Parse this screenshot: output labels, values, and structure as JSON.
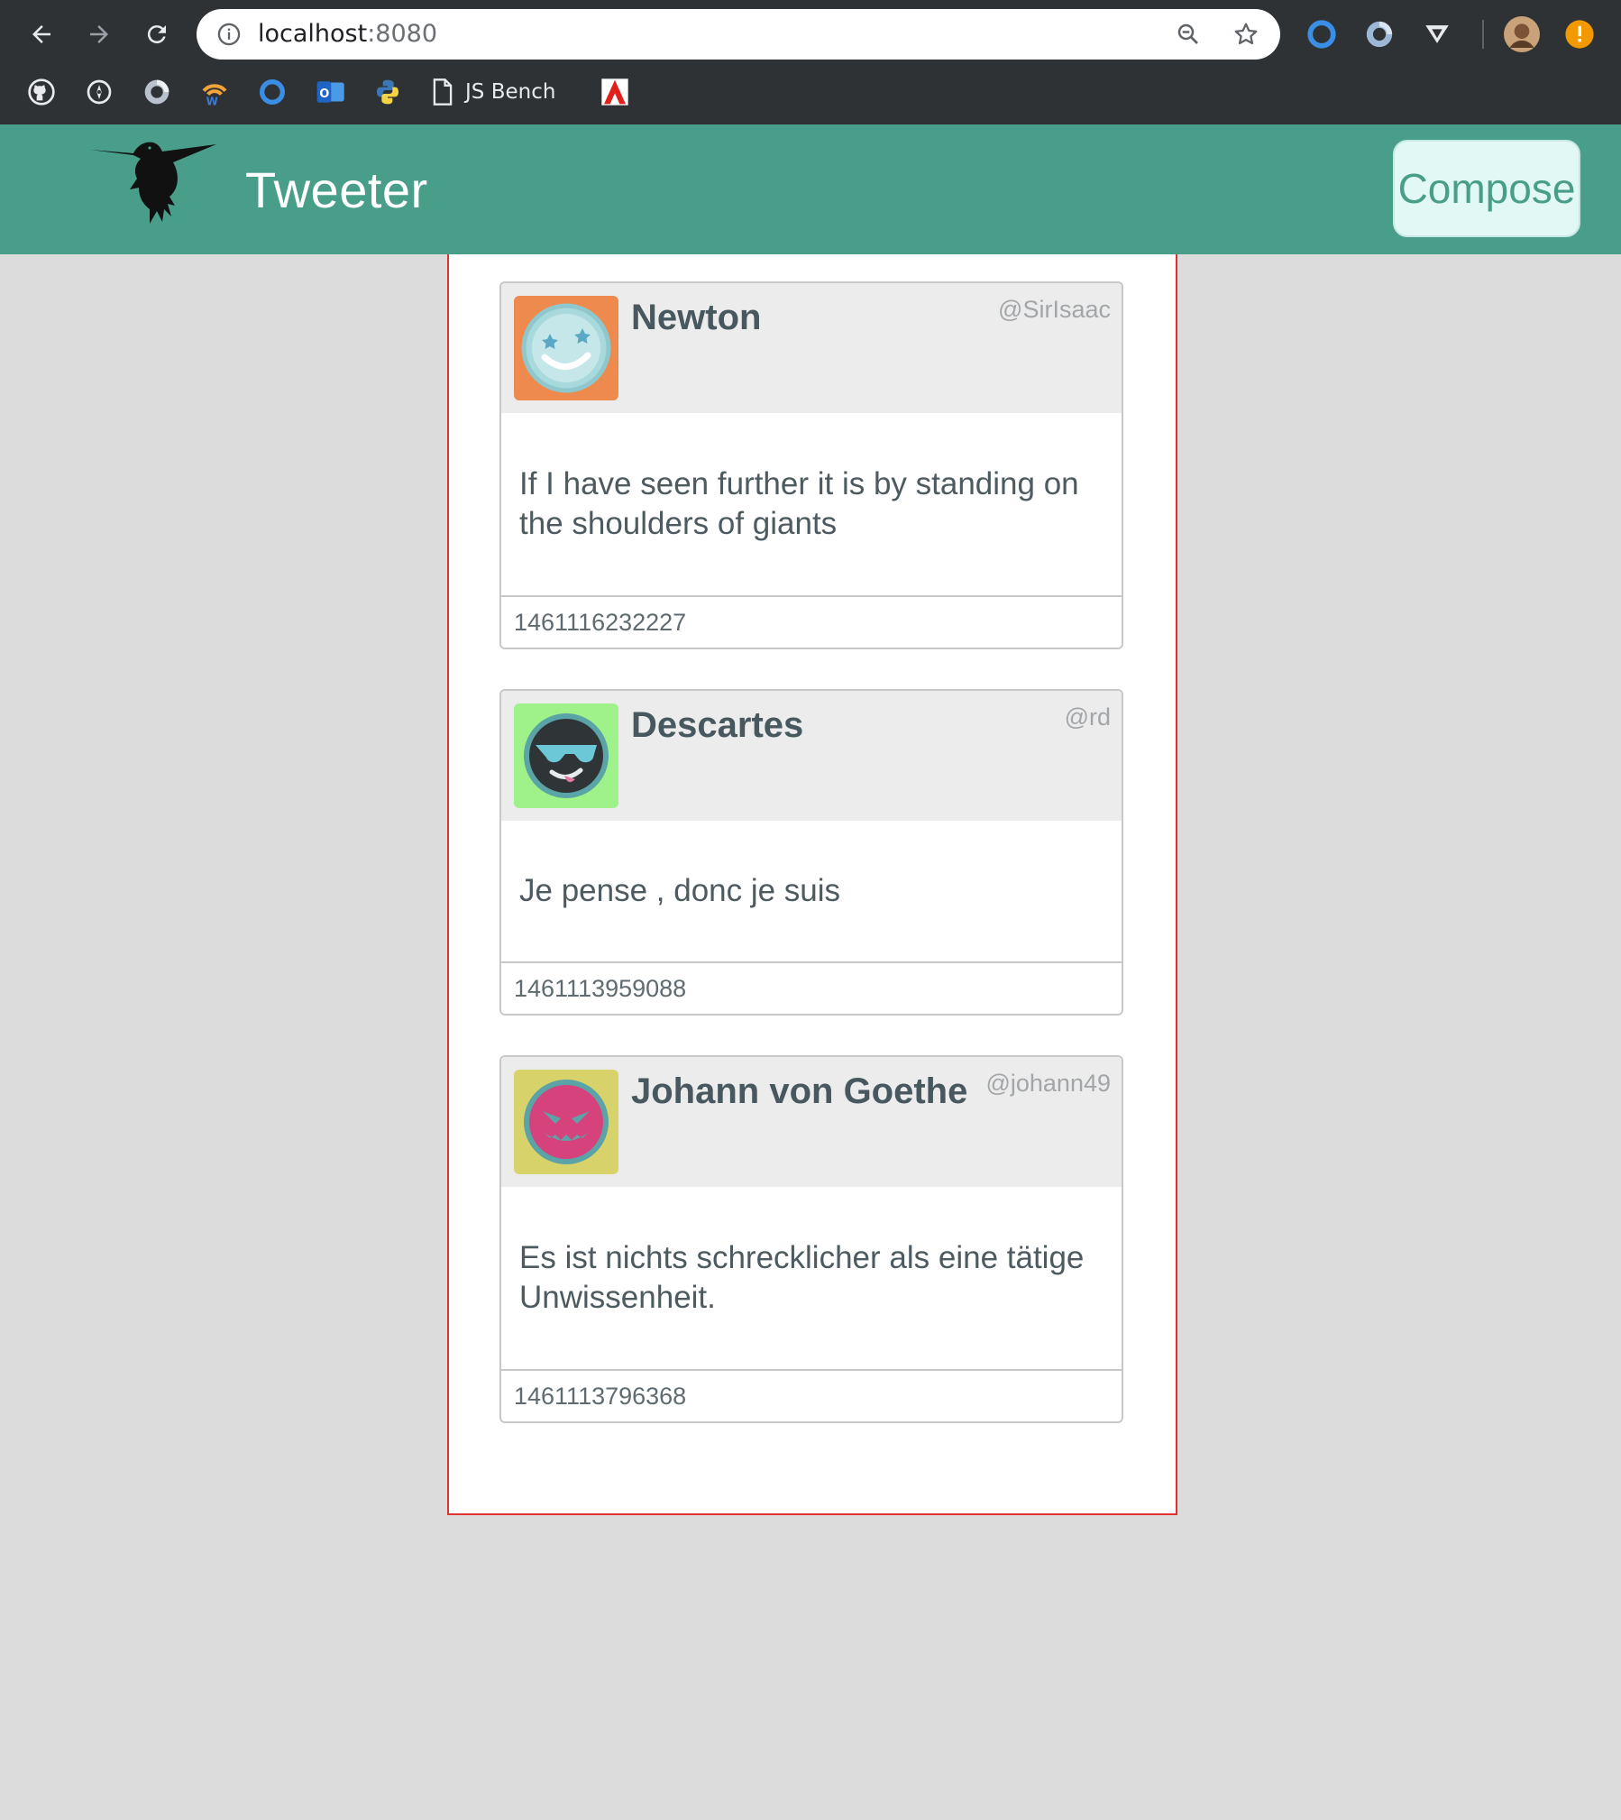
{
  "browser": {
    "url_host": "localhost",
    "url_port": ":8080",
    "bookmark_label": "JS Bench"
  },
  "app": {
    "title": "Tweeter",
    "compose_label": "Compose",
    "accent_color": "#489e88",
    "feed_border_color": "#e0322e"
  },
  "tweets": [
    {
      "name": "Newton",
      "handle": "@SirIsaac",
      "text": "If I have seen further it is by standing on the shoulders of giants",
      "timestamp": "1461116232227",
      "avatar_bg": "#ef8a4e",
      "avatar_face": "#a8d9dd"
    },
    {
      "name": "Descartes",
      "handle": "@rd",
      "text": "Je pense , donc je suis",
      "timestamp": "1461113959088",
      "avatar_bg": "#9ff28a",
      "avatar_face": "#2f3436"
    },
    {
      "name": "Johann von Goethe",
      "handle": "@johann49",
      "text": "Es ist nichts schrecklicher als eine tätige Unwissenheit.",
      "timestamp": "1461113796368",
      "avatar_bg": "#d7d36a",
      "avatar_face": "#d6427c"
    }
  ]
}
